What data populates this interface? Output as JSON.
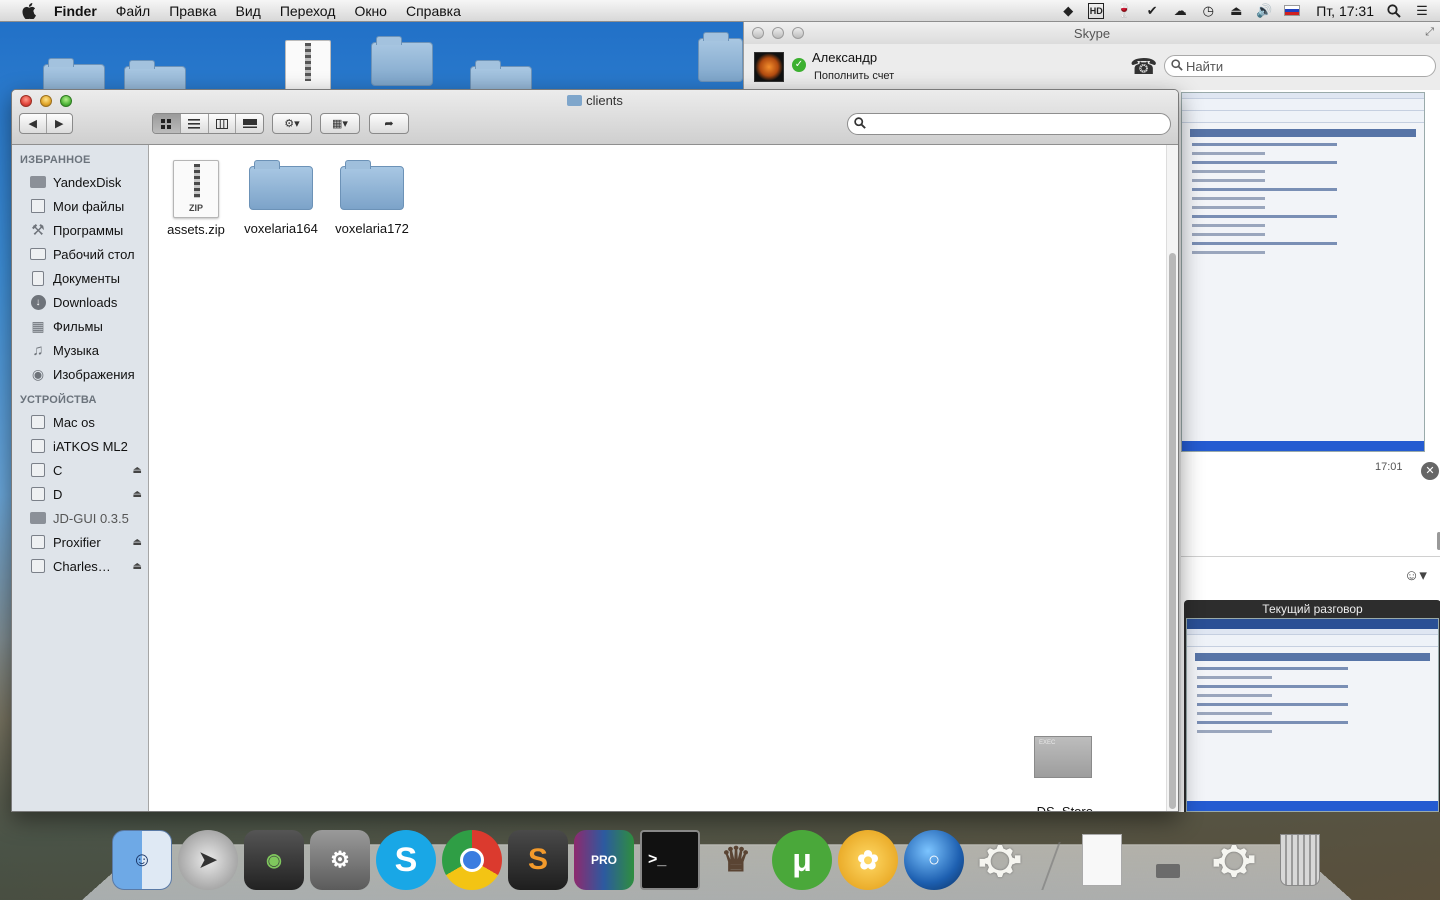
{
  "menubar": {
    "app_name": "Finder",
    "menus": [
      "Файл",
      "Правка",
      "Вид",
      "Переход",
      "Окно",
      "Справка"
    ],
    "clock": "Пт, 17:31",
    "tray_icons": [
      "evernote-icon",
      "hd-icon",
      "wine-glass-icon",
      "check-shield-icon",
      "cloud-icon",
      "time-machine-icon",
      "eject-icon",
      "volume-icon",
      "flag-ru-icon",
      "search-icon",
      "list-icon"
    ]
  },
  "finder": {
    "title": "clients",
    "favorites_header": "ИЗБРАННОЕ",
    "favorites": [
      {
        "label": "YandexDisk",
        "icon": "folder-icon"
      },
      {
        "label": "Мои файлы",
        "icon": "all-files-icon"
      },
      {
        "label": "Программы",
        "icon": "applications-icon"
      },
      {
        "label": "Рабочий стол",
        "icon": "desktop-icon"
      },
      {
        "label": "Документы",
        "icon": "documents-icon"
      },
      {
        "label": "Downloads",
        "icon": "downloads-icon"
      },
      {
        "label": "Фильмы",
        "icon": "movies-icon"
      },
      {
        "label": "Музыка",
        "icon": "music-icon"
      },
      {
        "label": "Изображения",
        "icon": "camera-icon"
      }
    ],
    "devices_header": "УСТРОЙСТВА",
    "devices": [
      {
        "label": "Mac os",
        "eject": false
      },
      {
        "label": "iATKOS ML2",
        "eject": false
      },
      {
        "label": "C",
        "eject": true
      },
      {
        "label": "D",
        "eject": true
      },
      {
        "label": "JD-GUI 0.3.5",
        "eject": false
      },
      {
        "label": "Proxifier",
        "eject": true
      },
      {
        "label": "Charles…",
        "eject": true
      }
    ],
    "files": [
      {
        "name": "assets.zip",
        "kind": "zip"
      },
      {
        "name": "voxelaria164",
        "kind": "folder"
      },
      {
        "name": "voxelaria172",
        "kind": "folder"
      }
    ],
    "ds_store": {
      "name": ".DS_Store"
    },
    "zip_badge": "ZIP"
  },
  "skype": {
    "title": "Skype",
    "user_name": "Александр",
    "credit_link": "Пополнить счет",
    "search_placeholder": "Найти",
    "message_time": "17:01",
    "current_call_title": "Текущий разговор"
  },
  "dock": {
    "apps": [
      "finder-icon",
      "launchpad-icon",
      "image-capture-icon",
      "system-preferences-icon",
      "skype-icon",
      "chrome-icon",
      "sublime-text-icon",
      "rar-pro-icon",
      "terminal-icon",
      "archiver-icon",
      "utorrent-icon",
      "growl-icon",
      "earth-icon",
      "pitcher-icon"
    ],
    "stack_items": [
      "document-icon",
      "drive-icon",
      "pitcher-icon",
      "trash-icon"
    ]
  }
}
